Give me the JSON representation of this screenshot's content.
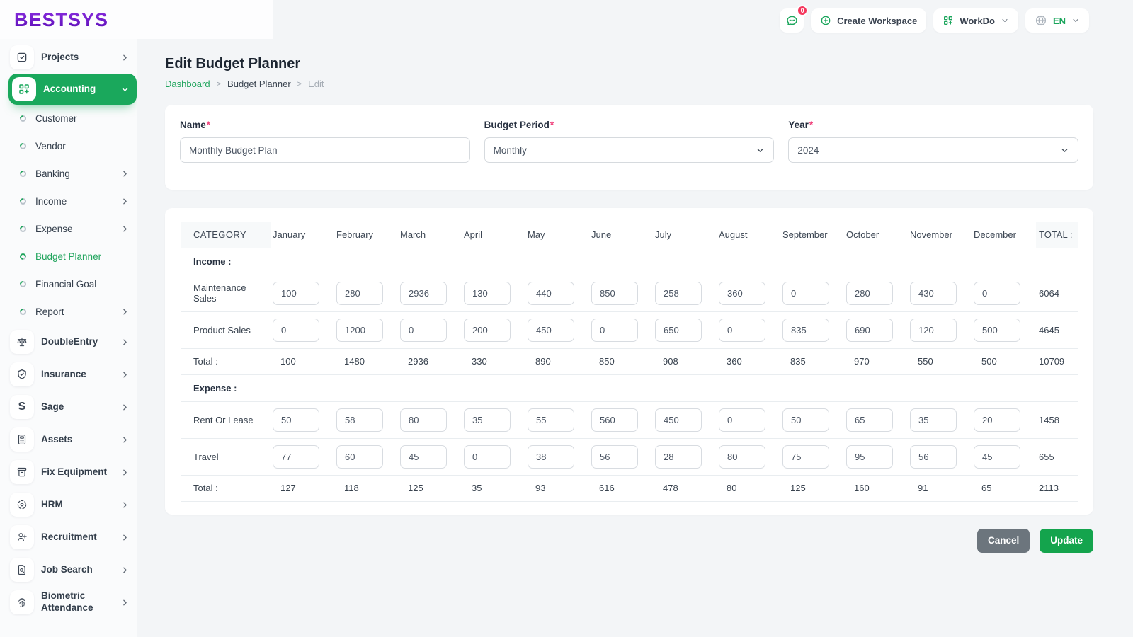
{
  "colors": {
    "accent_green": "#1aa85c",
    "link_green": "#22a55e",
    "badge_pink": "#f5365c",
    "required_pink": "#f0457e",
    "logo_purple": "#6c14c9",
    "cancel_gray": "#6c757d",
    "update_green": "#14a44d"
  },
  "brand": {
    "logo_text": "BESTSYS"
  },
  "topbar": {
    "chat_badge": "0",
    "create_workspace": "Create Workspace",
    "workspace_name": "WorkDo",
    "language": "EN"
  },
  "sidebar": {
    "items": [
      {
        "label": "Projects",
        "icon": "projects-icon",
        "style": "boxed",
        "chevron": "right"
      },
      {
        "label": "Accounting",
        "icon": "accounting-icon",
        "style": "boxed",
        "chevron": "down",
        "active": true
      },
      {
        "label": "Customer",
        "style": "sub"
      },
      {
        "label": "Vendor",
        "style": "sub"
      },
      {
        "label": "Banking",
        "style": "sub",
        "chevron": "right"
      },
      {
        "label": "Income",
        "style": "sub",
        "chevron": "right"
      },
      {
        "label": "Expense",
        "style": "sub",
        "chevron": "right"
      },
      {
        "label": "Budget Planner",
        "style": "sub",
        "active": true
      },
      {
        "label": "Financial Goal",
        "style": "sub"
      },
      {
        "label": "Report",
        "style": "sub",
        "chevron": "right"
      },
      {
        "label": "DoubleEntry",
        "icon": "double-entry-icon",
        "style": "boxed",
        "chevron": "right"
      },
      {
        "label": "Insurance",
        "icon": "insurance-icon",
        "style": "boxed",
        "chevron": "right"
      },
      {
        "label": "Sage",
        "icon": "sage-icon",
        "style": "boxed",
        "chevron": "right"
      },
      {
        "label": "Assets",
        "icon": "assets-icon",
        "style": "boxed",
        "chevron": "right"
      },
      {
        "label": "Fix Equipment",
        "icon": "fix-equipment-icon",
        "style": "boxed",
        "chevron": "right"
      },
      {
        "label": "HRM",
        "icon": "hrm-icon",
        "style": "boxed",
        "chevron": "right"
      },
      {
        "label": "Recruitment",
        "icon": "recruitment-icon",
        "style": "boxed",
        "chevron": "right"
      },
      {
        "label": "Job Search",
        "icon": "job-search-icon",
        "style": "boxed",
        "chevron": "right"
      },
      {
        "label": "Biometric Attendance",
        "icon": "biometric-icon",
        "style": "boxed",
        "chevron": "right"
      }
    ]
  },
  "page": {
    "title": "Edit Budget Planner",
    "breadcrumb": [
      {
        "label": "Dashboard",
        "type": "link"
      },
      {
        "label": "Budget Planner",
        "type": "current"
      },
      {
        "label": "Edit",
        "type": "muted"
      }
    ]
  },
  "form": {
    "name": {
      "label": "Name",
      "required": "*",
      "value": "Monthly Budget Plan"
    },
    "budget_period": {
      "label": "Budget Period",
      "required": "*",
      "value": "Monthly"
    },
    "year": {
      "label": "Year",
      "required": "*",
      "value": "2024"
    }
  },
  "budget_table": {
    "columns": [
      "CATEGORY",
      "January",
      "February",
      "March",
      "April",
      "May",
      "June",
      "July",
      "August",
      "September",
      "October",
      "November",
      "December",
      "TOTAL :"
    ],
    "sections": [
      {
        "heading": "Income :",
        "rows": [
          {
            "category": "Maintenance Sales",
            "values": [
              100,
              280,
              2936,
              130,
              440,
              850,
              258,
              360,
              0,
              280,
              430,
              0
            ],
            "total": 6064
          },
          {
            "category": "Product Sales",
            "values": [
              0,
              1200,
              0,
              200,
              450,
              0,
              650,
              0,
              835,
              690,
              120,
              500
            ],
            "total": 4645
          }
        ],
        "totals": {
          "label": "Total :",
          "values": [
            100,
            1480,
            2936,
            330,
            890,
            850,
            908,
            360,
            835,
            970,
            550,
            500
          ],
          "total": 10709
        }
      },
      {
        "heading": "Expense :",
        "rows": [
          {
            "category": "Rent Or Lease",
            "values": [
              50,
              58,
              80,
              35,
              55,
              560,
              450,
              0,
              50,
              65,
              35,
              20
            ],
            "total": 1458
          },
          {
            "category": "Travel",
            "values": [
              77,
              60,
              45,
              0,
              38,
              56,
              28,
              80,
              75,
              95,
              56,
              45
            ],
            "total": 655
          }
        ],
        "totals": {
          "label": "Total :",
          "values": [
            127,
            118,
            125,
            35,
            93,
            616,
            478,
            80,
            125,
            160,
            91,
            65
          ],
          "total": 2113
        }
      }
    ]
  },
  "actions": {
    "cancel": "Cancel",
    "update": "Update"
  }
}
